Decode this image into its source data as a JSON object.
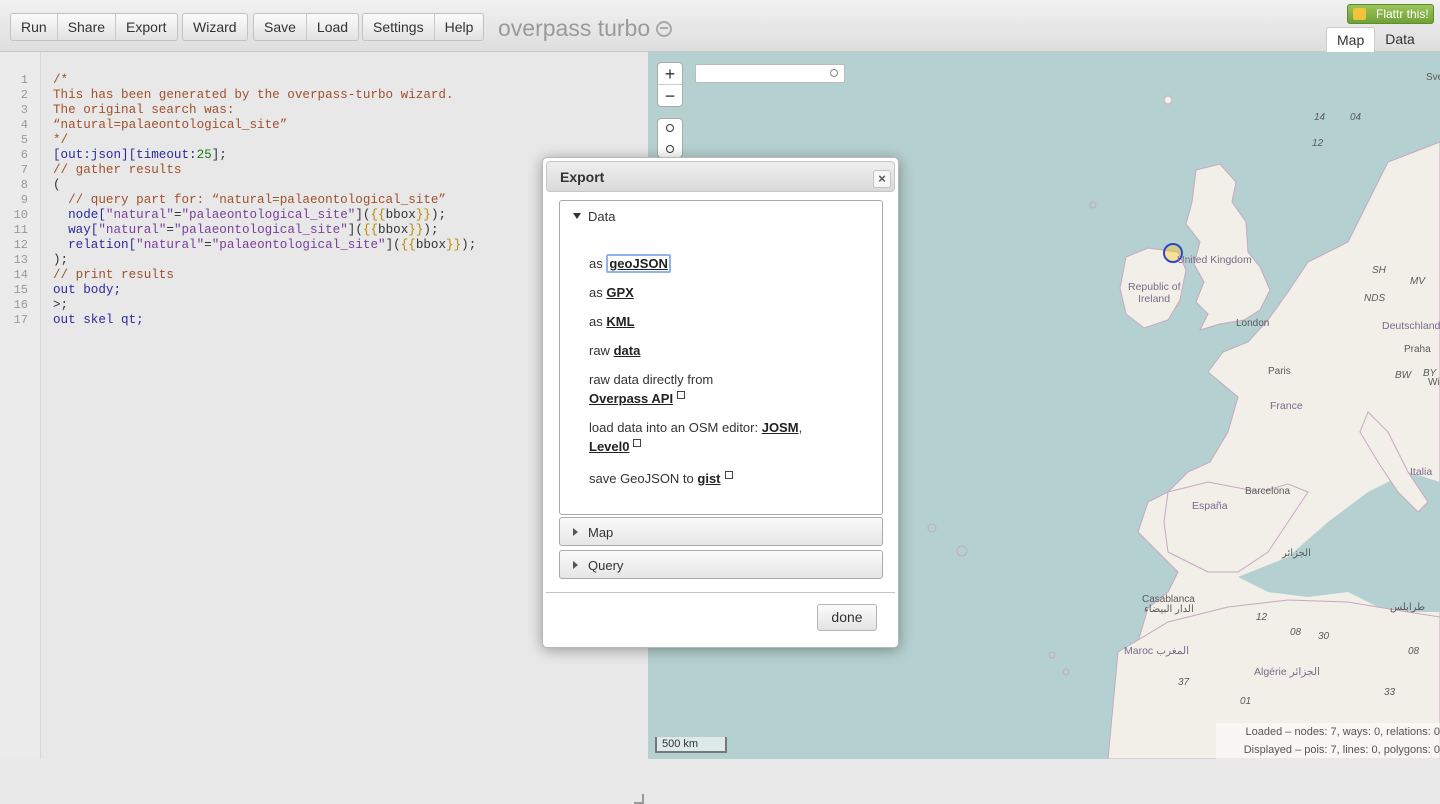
{
  "toolbar": {
    "run": "Run",
    "share": "Share",
    "export": "Export",
    "wizard": "Wizard",
    "save": "Save",
    "load": "Load",
    "settings": "Settings",
    "help": "Help"
  },
  "app_title": "overpass turbo",
  "flattr": "Flattr this!",
  "view_tabs": {
    "map": "Map",
    "data": "Data"
  },
  "editor": {
    "line_numbers": [
      "1",
      "2",
      "3",
      "4",
      "5",
      "6",
      "7",
      "8",
      "9",
      "10",
      "11",
      "12",
      "13",
      "14",
      "15",
      "16",
      "17"
    ]
  },
  "code": {
    "l1": "/*",
    "l2": "This has been generated by the overpass-turbo wizard.",
    "l3": "The original search was:",
    "l4": "“natural=palaeontological_site”",
    "l5": "*/",
    "l6a": "[out:json][timeout:",
    "l6b": "25",
    "l6c": "];",
    "l7": "// gather results",
    "l8": "(",
    "l9": "  // query part for: “natural=palaeontological_site”",
    "l10a": "  node[",
    "l10b": "\"natural\"",
    "l10c": "=",
    "l10d": "\"palaeontological_site\"",
    "l10e": "](",
    "l10f": "{{",
    "l10g": "bbox",
    "l10h": "}}",
    "l10i": ");",
    "l11a": "  way[",
    "l11b": "\"natural\"",
    "l11c": "=",
    "l11d": "\"palaeontological_site\"",
    "l11e": "](",
    "l11f": "{{",
    "l11g": "bbox",
    "l11h": "}}",
    "l11i": ");",
    "l12a": "  relation[",
    "l12b": "\"natural\"",
    "l12c": "=",
    "l12d": "\"palaeontological_site\"",
    "l12e": "](",
    "l12f": "{{",
    "l12g": "bbox",
    "l12h": "}}",
    "l12i": ");",
    "l13": ");",
    "l14": "// print results",
    "l15": "out body;",
    "l16": ">;",
    "l17": "out skel qt;"
  },
  "map": {
    "zoom_in": "+",
    "zoom_out": "−",
    "scale": "500 km",
    "labels": {
      "uk": "United Kingdom",
      "ireland1": "Republic of",
      "ireland2": "Ireland",
      "london": "London",
      "deutschland": "Deutschland",
      "praha": "Praha",
      "paris": "Paris",
      "france": "France",
      "italia": "Italia",
      "barcelona": "Barcelona",
      "espana": "España",
      "alger": "الجزائر",
      "casablanca1": "Casablanca",
      "casablanca2": "الدار البيضاء",
      "maroc": "Maroc المغرب",
      "algerie": "Algérie الجزائر",
      "tripoli": "طرابلس",
      "sh": "SH",
      "nds": "NDS",
      "bw": "BW",
      "mv": "MV",
      "by": "BY",
      "wien": "Wie",
      "sve": "Sve",
      "n14": "14",
      "n04": "04",
      "n12": "12",
      "n08": "08",
      "n01": "01",
      "n37": "37",
      "n01b": "01",
      "n33": "33",
      "n30": "30",
      "n12b": "12",
      "n08b": "08"
    },
    "status_loaded_label": "Loaded",
    "status_loaded": " – nodes: 7, ways: 0, relations: 0",
    "status_displayed_label": "Displayed",
    "status_displayed": " – pois: 7, lines: 0, polygons: 0"
  },
  "dialog": {
    "title": "Export",
    "close": "×",
    "sections": {
      "data": "Data",
      "map": "Map",
      "query": "Query"
    },
    "items": {
      "as1": "as",
      "geojson": "geoJSON",
      "as2": "as",
      "gpx": "GPX",
      "as3": "as",
      "kml": "KML",
      "raw": "raw",
      "data": "data",
      "raw_direct": "raw data directly from",
      "overpass_api": "Overpass API",
      "load_into": "load data into an OSM editor: ",
      "josm": "JOSM",
      "comma": ",",
      "level0": "Level0",
      "save_geojson": "save GeoJSON to ",
      "gist": "gist"
    },
    "done": "done"
  },
  "colors": {
    "water": "#b5d0d0",
    "land": "#f2efe9",
    "accent_green": "#6fa137"
  }
}
